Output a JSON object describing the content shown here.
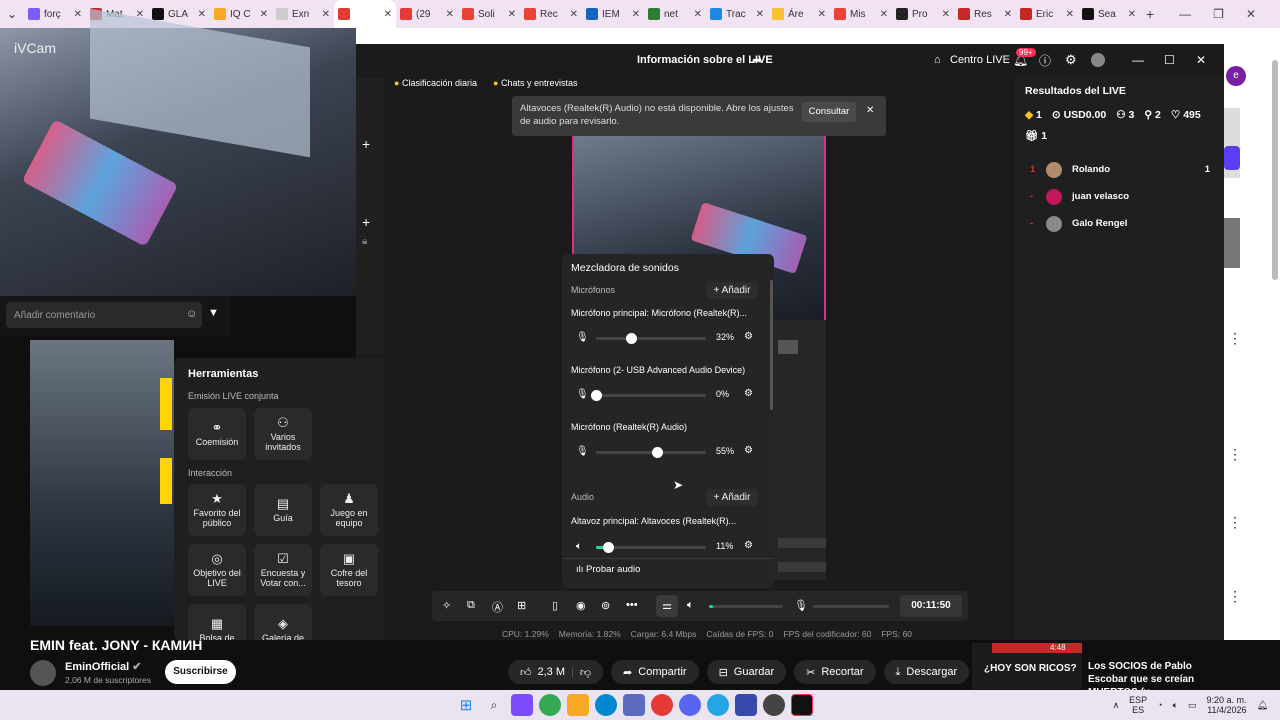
{
  "tabs": [
    {
      "label": "forç",
      "color": "#7b5cff"
    },
    {
      "label": "Mat",
      "color": "#c62828"
    },
    {
      "label": "GLA",
      "color": "#111"
    },
    {
      "label": "IQ C",
      "color": "#f9a825"
    },
    {
      "label": "Exn",
      "color": "#ccc"
    },
    {
      "label": "",
      "color": "#e53935"
    },
    {
      "label": "(29",
      "color": "#e53935"
    },
    {
      "label": "Soli",
      "color": "#ea4335"
    },
    {
      "label": "Rec",
      "color": "#ea4335"
    },
    {
      "label": "IEM",
      "color": "#1565c0"
    },
    {
      "label": "net",
      "color": "#2e7d32"
    },
    {
      "label": "Trac",
      "color": "#1e88e5"
    },
    {
      "label": "Áre",
      "color": "#fbc02d"
    },
    {
      "label": "Mis",
      "color": "#ea4335"
    },
    {
      "label": "Pro",
      "color": "#222"
    },
    {
      "label": "Res",
      "color": "#c62828"
    },
    {
      "label": "Eric",
      "color": "#c62828"
    },
    {
      "label": "Sea",
      "color": "#111"
    }
  ],
  "studio": {
    "title": "Información sobre el LIVE",
    "centro": "Centro LIVE",
    "notif_count": "99+",
    "top_tabs": {
      "daily": "Clasificación diaria",
      "chats": "Chats y entrevistas"
    },
    "alert": {
      "text": "Altavoces (Realtek(R) Audio) no está disponible. Abre los ajustes de audio para revisarlo.",
      "action": "Consultar"
    },
    "comment_placeholder": "Añadir comentario",
    "ivcam": "iVCam"
  },
  "mixer": {
    "title": "Mezcladora de sonidos",
    "mics_label": "Micrófonos",
    "add": "+ Añadir",
    "audio_label": "Audio",
    "test": "Probar audio",
    "channels": [
      {
        "name": "Micrófono principal: Micrófono (Realtek(R)...",
        "value": "32%",
        "level": 0.32
      },
      {
        "name": "Micrófono (2- USB Advanced Audio Device)",
        "value": "0%",
        "level": 0.0
      },
      {
        "name": "Micrófono (Realtek(R) Audio)",
        "value": "55%",
        "level": 0.55
      }
    ],
    "speaker": {
      "name": "Altavoz principal: Altavoces (Realtek(R)...",
      "value": "11%",
      "level": 0.11
    }
  },
  "tools": {
    "title": "Herramientas",
    "joint_label": "Emisión LIVE conjunta",
    "joint": [
      {
        "label": "Coemisión",
        "icon": "link-icon"
      },
      {
        "label": "Varios invitados",
        "icon": "group-icon"
      }
    ],
    "interaction_label": "Interacción",
    "interaction": [
      {
        "label": "Favorito del público",
        "icon": "star-person-icon"
      },
      {
        "label": "Guía",
        "icon": "book-icon"
      },
      {
        "label": "Juego en equipo",
        "icon": "team-icon"
      },
      {
        "label": "Objetivo del LIVE",
        "icon": "target-icon"
      },
      {
        "label": "Encuesta y Votar con...",
        "icon": "poll-icon"
      },
      {
        "label": "Cofre del tesoro",
        "icon": "chest-icon"
      },
      {
        "label": "Bolsa de",
        "icon": "bag-icon"
      },
      {
        "label": "Galería de",
        "icon": "gallery-icon"
      }
    ]
  },
  "controls": {
    "timer": "00:11:50",
    "volume_level": 0.05
  },
  "stats": {
    "cpu": "CPU: 1.29%",
    "memory": "Memoria: 1.82%",
    "load": "Cargar: 6.4 Mbps",
    "fps_drops": "Caídas de FPS: 0",
    "encoder_fps": "FPS del codificador: 60",
    "fps": "FPS: 60"
  },
  "results": {
    "title": "Resultados del LIVE",
    "gems": "1",
    "usd": "USD0.00",
    "viewers": "3",
    "followers": "2",
    "likes": "495",
    "gifts": "1",
    "rank": [
      {
        "pos": "1",
        "name": "Rolando",
        "score": "1",
        "color": "#b08c6a"
      },
      {
        "pos": "-",
        "name": "juan velasco",
        "score": "",
        "color": "#c2185b"
      },
      {
        "pos": "-",
        "name": "Galo Rengel",
        "score": "",
        "color": "#8a8a8a"
      }
    ]
  },
  "youtube": {
    "video_title": "EMIN feat. JONY - КАМИН",
    "channel": "EminOfficial",
    "subs": "2,06 M de suscriptores",
    "subscribe": "Suscribirse",
    "likes": "2,3 M",
    "share": "Compartir",
    "save": "Guardar",
    "clip": "Recortar",
    "download": "Descargar",
    "rec_title": "Los SOCIOS de Pablo Escobar que se creían MUERTOS (y ...",
    "rec_thumb_text": "¿HOY SON RICOS?",
    "rec_duration": "4:48"
  },
  "taskbar": {
    "lang1": "ESP",
    "lang2": "ES",
    "time": "9:20 a. m.",
    "date": "11/4/2026"
  }
}
